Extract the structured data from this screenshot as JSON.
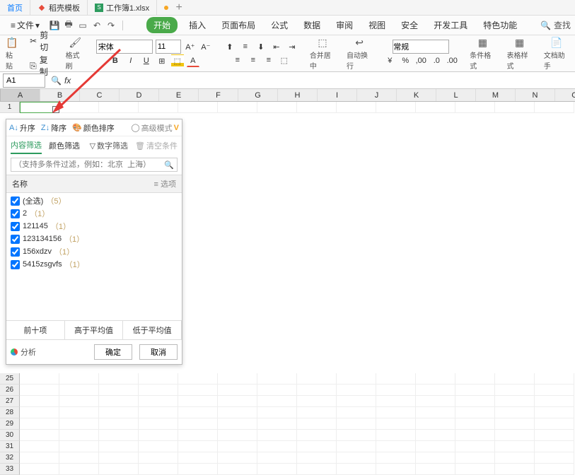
{
  "tabs": {
    "home": "首页",
    "template": "稻壳模板",
    "workbook": "工作簿1.xlsx"
  },
  "menu": {
    "file": "文件"
  },
  "ribbon": {
    "start": "开始",
    "insert": "插入",
    "page": "页面布局",
    "formula": "公式",
    "data": "数据",
    "review": "审阅",
    "view": "视图",
    "security": "安全",
    "dev": "开发工具",
    "special": "特色功能"
  },
  "search": "查找",
  "clipboard": {
    "cut": "剪切",
    "copy": "复制",
    "paste": "粘贴",
    "format": "格式刷"
  },
  "font": {
    "name": "宋体",
    "size": "11"
  },
  "merge": "合并居中",
  "wrap": "自动换行",
  "numfmt": "常规",
  "cond": "条件格式",
  "tablestyle": "表格样式",
  "dochelper": "文档助手",
  "namebox": "A1",
  "cols": [
    "A",
    "B",
    "C",
    "D",
    "E",
    "F",
    "G",
    "H",
    "I",
    "J",
    "K",
    "L",
    "M",
    "N",
    "O"
  ],
  "row1": "1",
  "rows_tail": [
    "25",
    "26",
    "27",
    "28",
    "29",
    "30",
    "31",
    "32",
    "33"
  ],
  "filter": {
    "asc": "升序",
    "desc": "降序",
    "color_sort": "颜色排序",
    "adv": "高级模式",
    "content": "内容筛选",
    "color_filter": "颜色筛选",
    "num_filter": "数字筛选",
    "clear": "清空条件",
    "placeholder": "（支持多条件过滤，例如：北京  上海）",
    "name_hdr": "名称",
    "opt_hdr": "选项",
    "items": [
      {
        "label": "(全选)",
        "count": "（5）"
      },
      {
        "label": "2",
        "count": "（1）"
      },
      {
        "label": "121145",
        "count": "（1）"
      },
      {
        "label": "123134156",
        "count": "（1）"
      },
      {
        "label": "156xdzv",
        "count": "（1）"
      },
      {
        "label": "5415zsgvfs",
        "count": "（1）"
      }
    ],
    "top10": "前十项",
    "above": "高于平均值",
    "below": "低于平均值",
    "analyze": "分析",
    "ok": "确定",
    "cancel": "取消"
  }
}
